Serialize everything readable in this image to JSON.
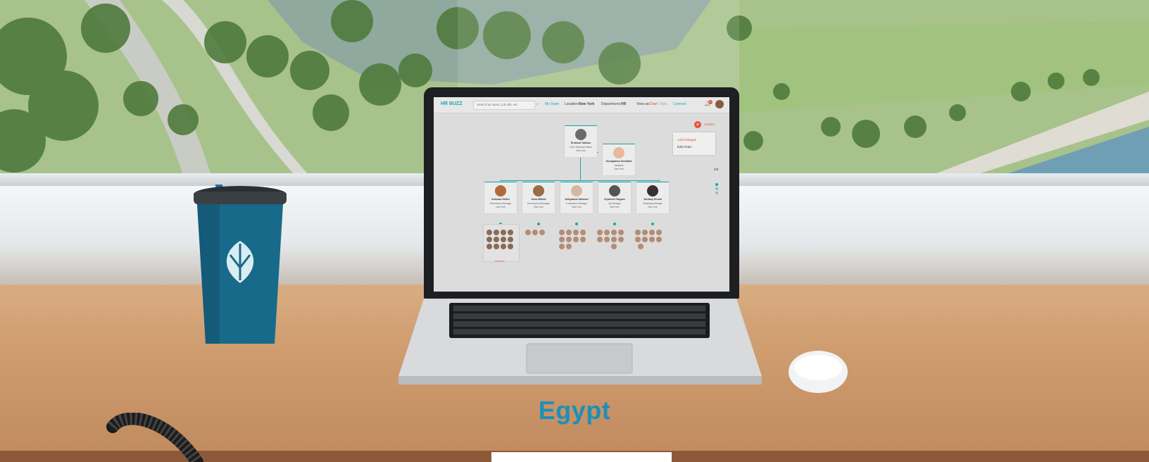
{
  "scene": {
    "title": "Egypt",
    "colors": {
      "accent": "#1d8fb9",
      "app_teal": "#19a9a6",
      "app_red": "#e8533b",
      "desk": "#d4a476"
    }
  },
  "app": {
    "logo": "HR BUZZ",
    "search_placeholder": "Search by name, job title, etc.",
    "nav": {
      "my_team": "My Team",
      "location_label": "Location:",
      "location_value": "New York",
      "department_label": "Department:",
      "department_value": "HR",
      "view_label": "View as:",
      "view_value": "Chart",
      "view_alt": "Table",
      "connect": "Connect"
    },
    "notification_count": "2",
    "actions_button": "Actions",
    "menu": {
      "item1": "Add Delegate",
      "item2": "Edit Chart"
    },
    "page_indicator": "2/3",
    "root": {
      "name": "Erotissa Tobiasz",
      "role": "Chief Technical Officer",
      "location": "New York"
    },
    "assistant": {
      "name": "Georgianna Goodbolt",
      "role": "Assistant",
      "location": "New York"
    },
    "reports": [
      {
        "name": "Anissan Hellen",
        "role": "Recruitment Manager",
        "location": "New York"
      },
      {
        "name": "Ilona Mifolia",
        "role": "Development Manager",
        "location": "New York"
      },
      {
        "name": "Ankyalana Galvumi",
        "role": "Localization Manager",
        "location": "New York"
      },
      {
        "name": "Kyancrid Vargam",
        "role": "QA Manager",
        "location": "New York"
      },
      {
        "name": "Yarhavy Knosh",
        "role": "Marketing Manager",
        "location": "New York"
      }
    ],
    "view_more": "+8 more"
  }
}
